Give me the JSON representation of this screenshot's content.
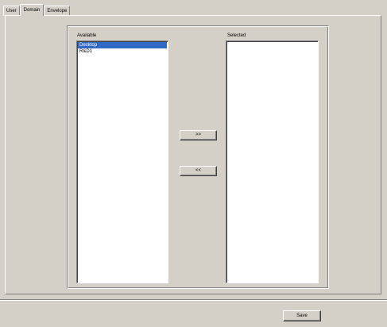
{
  "tabs": [
    {
      "label": "User",
      "active": false
    },
    {
      "label": "Domain",
      "active": true
    },
    {
      "label": "Envelope",
      "active": false
    }
  ],
  "available": {
    "label": "Available",
    "items": [
      {
        "label": "Desktop",
        "selected": true
      },
      {
        "label": "R&D1",
        "selected": false
      }
    ]
  },
  "selected": {
    "label": "Selected",
    "items": []
  },
  "buttons": {
    "move_right": ">>",
    "move_left": "<<",
    "save": "Save"
  },
  "colors": {
    "face": "#d4d0c8",
    "selection": "#316ac5",
    "list_background": "#ffffff"
  }
}
